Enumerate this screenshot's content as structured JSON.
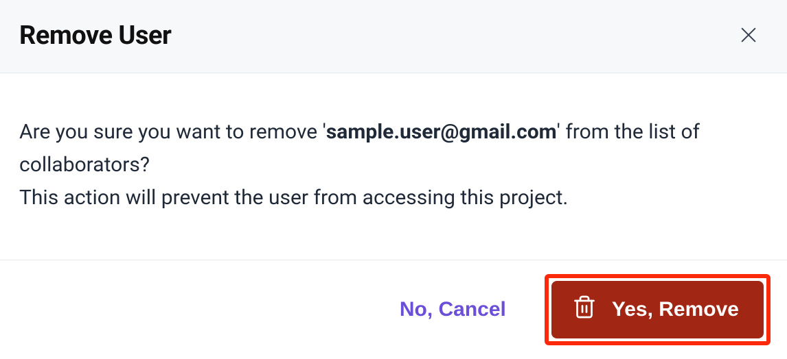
{
  "dialog": {
    "title": "Remove User",
    "confirm_prefix": "Are you sure you want to remove '",
    "user_email": "sample.user@gmail.com",
    "confirm_suffix": "' from the list of collaborators?",
    "warning_text": "This action will prevent the user from accessing this project.",
    "cancel_label": "No, Cancel",
    "confirm_label": "Yes, Remove"
  }
}
